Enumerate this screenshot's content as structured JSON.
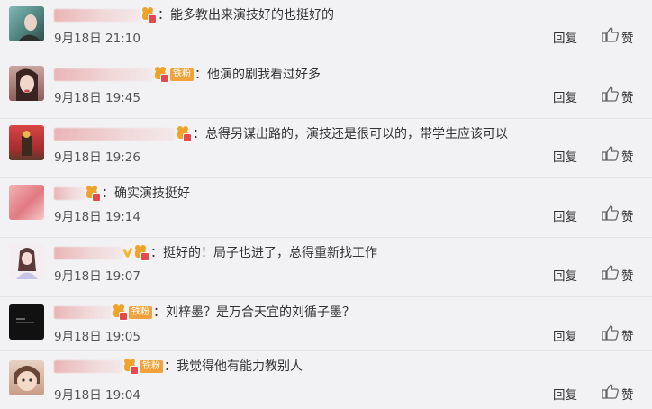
{
  "actions": {
    "reply_label": "回复",
    "like_label": "赞"
  },
  "badges": {
    "fan_label": "铁粉"
  },
  "comments": [
    {
      "text": "：能多教出来演技好的也挺好的",
      "time": "9月18日 21:10"
    },
    {
      "text": "：他演的剧我看过好多",
      "time": "9月18日 19:45"
    },
    {
      "text": "：总得另谋出路的，演技还是很可以的，带学生应该可以",
      "time": "9月18日 19:26"
    },
    {
      "text": "：确实演技挺好",
      "time": "9月18日 19:14"
    },
    {
      "text": "：挺好的！局子也进了，总得重新找工作",
      "time": "9月18日 19:07"
    },
    {
      "text": "：刘梓墨？是万合天宜的刘循子墨？",
      "time": "9月18日 19:05"
    },
    {
      "text": "：我觉得他有能力教别人",
      "time": "9月18日 19:04"
    }
  ]
}
